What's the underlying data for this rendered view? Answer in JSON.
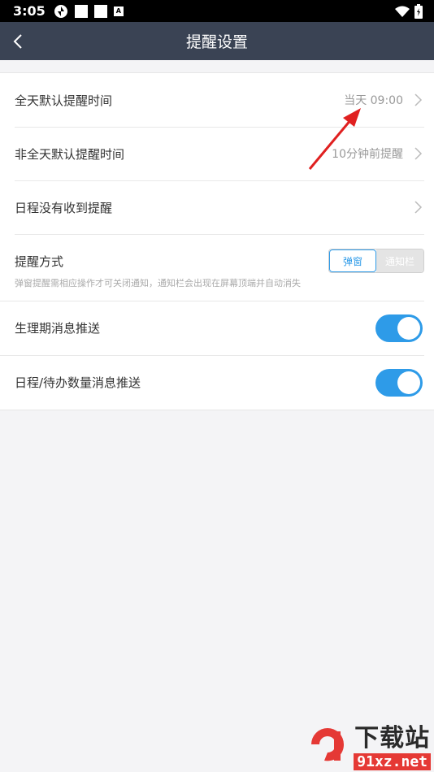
{
  "status_bar": {
    "time": "3:05",
    "badge_letter": "A"
  },
  "header": {
    "title": "提醒设置"
  },
  "settings": {
    "allday_label": "全天默认提醒时间",
    "allday_value": "当天 09:00",
    "nonallday_label": "非全天默认提醒时间",
    "nonallday_value": "10分钟前提醒",
    "missed_label": "日程没有收到提醒"
  },
  "reminder_mode": {
    "label": "提醒方式",
    "options": [
      "弹窗",
      "通知栏"
    ],
    "selected": "弹窗",
    "hint": "弹窗提醒需相应操作才可关闭通知，通知栏会出现在屏幕顶端并自动消失"
  },
  "toggles": {
    "period_label": "生理期消息推送",
    "period_on": true,
    "schedule_label": "日程/待办数量消息推送",
    "schedule_on": true
  },
  "watermark": {
    "brand": "下载站",
    "url": "91xz.net"
  },
  "colors": {
    "header_bg": "#3a4354",
    "accent": "#2e9be8",
    "arrow": "#e02020"
  }
}
